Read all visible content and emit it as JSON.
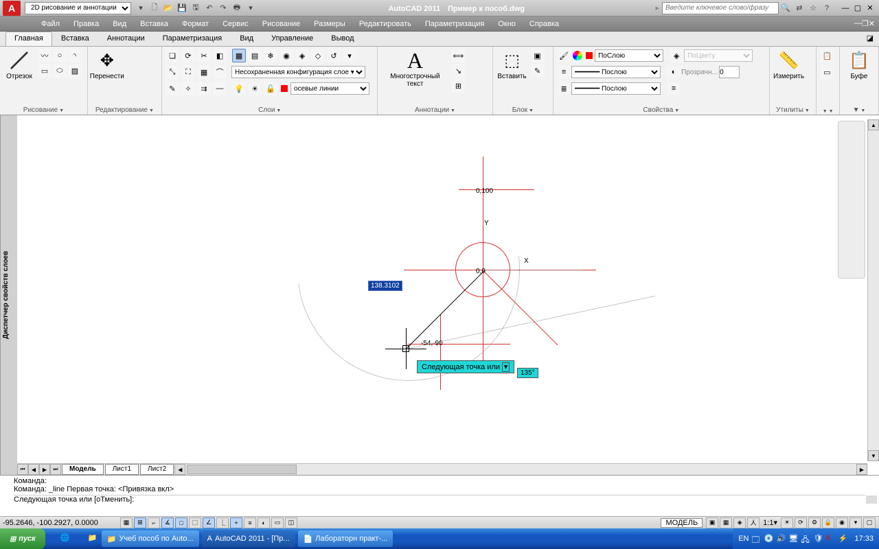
{
  "titlebar": {
    "workspace": "2D рисование и аннотации",
    "app_title": "AutoCAD 2011",
    "doc_title": "Пример к пособ.dwg",
    "search_placeholder": "Введите ключевое слово/фразу"
  },
  "menubar": [
    "Файл",
    "Правка",
    "Вид",
    "Вставка",
    "Формат",
    "Сервис",
    "Рисование",
    "Размеры",
    "Редактировать",
    "Параметризация",
    "Окно",
    "Справка"
  ],
  "ribbon_tabs": [
    "Главная",
    "Вставка",
    "Аннотации",
    "Параметризация",
    "Вид",
    "Управление",
    "Вывод"
  ],
  "ribbon_active_tab": 0,
  "panels": {
    "draw": {
      "title": "Рисование",
      "main_label": "Отрезок"
    },
    "modify": {
      "title": "Редактирование",
      "main_label": "Перенести"
    },
    "layers": {
      "title": "Слои",
      "unsaved_config": "Несохраненная конфигурация слое ▾",
      "current_layer": "осевые линии"
    },
    "annotation": {
      "title": "Аннотации",
      "main_label": "Многострочный текст"
    },
    "block": {
      "title": "Блок",
      "main_label": "Вставить"
    },
    "properties": {
      "title": "Свойства",
      "color": "ПоСлою",
      "linetype": "Послою",
      "lineweight": "Послою",
      "bycolor": "ПоЦвету",
      "transparency_label": "Прозрачн...",
      "transparency_value": "0"
    },
    "utilities": {
      "title": "Утилиты",
      "main_label": "Измерить"
    },
    "clipboard": {
      "title": "",
      "main_label": "Буфе"
    }
  },
  "layer_palette_title": "Диспетчер свойств слоев",
  "canvas": {
    "point_origin": "0,0",
    "point_top": "0,100",
    "point_pick": "-54,-90",
    "axis_x": "X",
    "axis_y": "Y",
    "dim_value": "138.3102",
    "tooltip": "Следующая точка или",
    "angle": "135°"
  },
  "model_tabs": [
    "Модель",
    "Лист1",
    "Лист2"
  ],
  "command": {
    "line1": "Команда:",
    "line2": "Команда: _line Первая точка:  <Привязка вкл>",
    "prompt": "Следующая точка или [оТменить]:"
  },
  "status": {
    "coords": "-95.2646, -100.2927, 0.0000",
    "model_button": "МОДЕЛЬ",
    "scale": "1:1"
  },
  "taskbar": {
    "start": "пуск",
    "tasks": [
      {
        "label": "Учеб пособ по Auto..."
      },
      {
        "label": "AutoCAD 2011 - [Пр..."
      },
      {
        "label": "Лабораторн практ-..."
      }
    ],
    "lang": "EN",
    "time": "17:33"
  }
}
